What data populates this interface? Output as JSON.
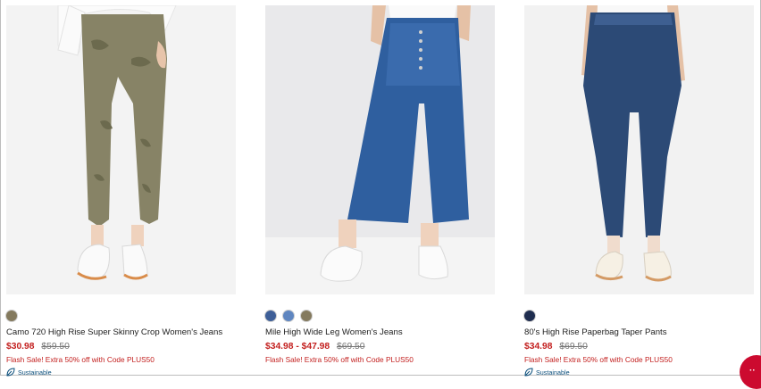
{
  "products": [
    {
      "name": "Camo 720 High Rise Super Skinny Crop Women's Jeans",
      "sale_price": "$30.98",
      "original_price": "$59.50",
      "promo": "Flash Sale! Extra 50% off with Code PLUS50",
      "badge": "Sustainable",
      "swatches": [
        "#847a5e"
      ]
    },
    {
      "name": "Mile High Wide Leg Women's Jeans",
      "sale_price": "$34.98 - $47.98",
      "original_price": "$69.50",
      "promo": "Flash Sale! Extra 50% off with Code PLUS50",
      "swatches": [
        "#3e5f98",
        "#5f86c0",
        "#847a5e"
      ]
    },
    {
      "name": "80's High Rise Paperbag Taper Pants",
      "sale_price": "$34.98",
      "original_price": "$69.50",
      "promo": "Flash Sale! Extra 50% off with Code PLUS50",
      "badge": "Sustainable",
      "swatches": [
        "#1f2d4f"
      ]
    }
  ],
  "colors": {
    "sale": "#c3201f",
    "badge": "#0b4f7c",
    "chat": "#cc0a2f"
  },
  "icons": {
    "badge": "leaf-icon",
    "chat": "chat-icon"
  }
}
